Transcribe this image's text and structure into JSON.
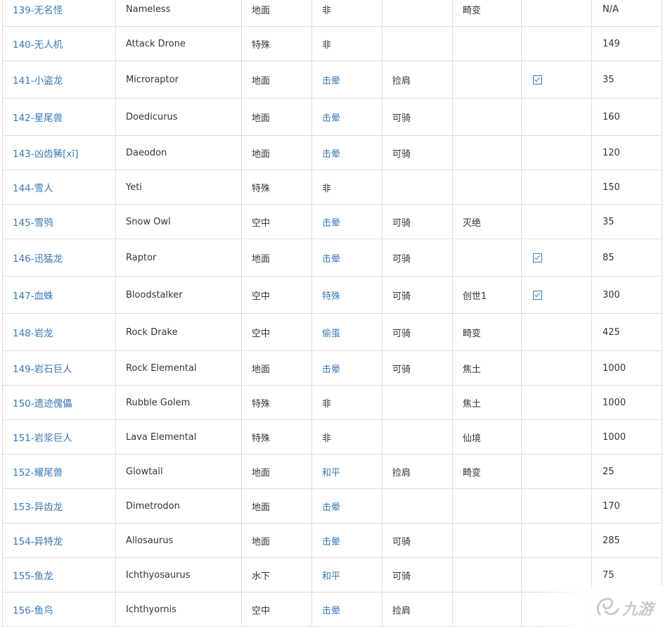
{
  "table": {
    "rows": [
      {
        "id": "139-无名怪",
        "name": "Nameless",
        "habitat": "地面",
        "tame": "非",
        "use": "",
        "map": "畸变",
        "extra": "",
        "value": "N/A",
        "tame_link": false,
        "checked": false
      },
      {
        "id": "140-无人机",
        "name": "Attack Drone",
        "habitat": "特殊",
        "tame": "非",
        "use": "",
        "map": "",
        "extra": "",
        "value": "149",
        "tame_link": false,
        "checked": false
      },
      {
        "id": "141-小盗龙",
        "name": "Microraptor",
        "habitat": "地面",
        "tame": "击晕",
        "use": "捡肩",
        "map": "",
        "extra": "",
        "value": "35",
        "tame_link": true,
        "checked": true
      },
      {
        "id": "142-星尾兽",
        "name": "Doedicurus",
        "habitat": "地面",
        "tame": "击晕",
        "use": "可骑",
        "map": "",
        "extra": "",
        "value": "160",
        "tame_link": true,
        "checked": false
      },
      {
        "id": "143-凶齿豨[xī]",
        "name": "Daeodon",
        "habitat": "地面",
        "tame": "击晕",
        "use": "可骑",
        "map": "",
        "extra": "",
        "value": "120",
        "tame_link": true,
        "checked": false
      },
      {
        "id": "144-雪人",
        "name": "Yeti",
        "habitat": "特殊",
        "tame": "非",
        "use": "",
        "map": "",
        "extra": "",
        "value": "150",
        "tame_link": false,
        "checked": false
      },
      {
        "id": "145-雪鸮",
        "name": "Snow Owl",
        "habitat": "空中",
        "tame": "击晕",
        "use": "可骑",
        "map": "灭绝",
        "extra": "",
        "value": "35",
        "tame_link": true,
        "checked": false
      },
      {
        "id": "146-迅猛龙",
        "name": "Raptor",
        "habitat": "地面",
        "tame": "击晕",
        "use": "可骑",
        "map": "",
        "extra": "",
        "value": "85",
        "tame_link": true,
        "checked": true
      },
      {
        "id": "147-血蛛",
        "name": "Bloodstalker",
        "habitat": "空中",
        "tame": "特殊",
        "use": "可骑",
        "map": "创世1",
        "extra": "",
        "value": "300",
        "tame_link": true,
        "checked": true
      },
      {
        "id": "148-岩龙",
        "name": "Rock Drake",
        "habitat": "空中",
        "tame": "偷蛋",
        "use": "可骑",
        "map": "畸变",
        "extra": "",
        "value": "425",
        "tame_link": true,
        "checked": false
      },
      {
        "id": "149-岩石巨人",
        "name": "Rock Elemental",
        "habitat": "地面",
        "tame": "击晕",
        "use": "可骑",
        "map": "焦土",
        "extra": "",
        "value": "1000",
        "tame_link": true,
        "checked": false
      },
      {
        "id": "150-遗迹傀儡",
        "name": "Rubble Golem",
        "habitat": "特殊",
        "tame": "非",
        "use": "",
        "map": "焦土",
        "extra": "",
        "value": "1000",
        "tame_link": false,
        "checked": false
      },
      {
        "id": "151-岩浆巨人",
        "name": "Lava Elemental",
        "habitat": "特殊",
        "tame": "非",
        "use": "",
        "map": "仙境",
        "extra": "",
        "value": "1000",
        "tame_link": false,
        "checked": false
      },
      {
        "id": "152-耀尾兽",
        "name": "Glowtail",
        "habitat": "地面",
        "tame": "和平",
        "use": "捡肩",
        "map": "畸变",
        "extra": "",
        "value": "25",
        "tame_link": true,
        "checked": false
      },
      {
        "id": "153-异齿龙",
        "name": "Dimetrodon",
        "habitat": "地面",
        "tame": "击晕",
        "use": "",
        "map": "",
        "extra": "",
        "value": "170",
        "tame_link": true,
        "checked": false
      },
      {
        "id": "154-异特龙",
        "name": "Allosaurus",
        "habitat": "地面",
        "tame": "击晕",
        "use": "可骑",
        "map": "",
        "extra": "",
        "value": "285",
        "tame_link": true,
        "checked": false
      },
      {
        "id": "155-鱼龙",
        "name": "Ichthyosaurus",
        "habitat": "水下",
        "tame": "和平",
        "use": "可骑",
        "map": "",
        "extra": "",
        "value": "75",
        "tame_link": true,
        "checked": false
      },
      {
        "id": "156-鱼鸟",
        "name": "Ichthyornis",
        "habitat": "空中",
        "tame": "击晕",
        "use": "捡肩",
        "map": "",
        "extra": "",
        "value": "",
        "tame_link": true,
        "checked": false
      }
    ]
  },
  "watermark": {
    "text": "九游",
    "icon": "jiuyou-logo-icon"
  },
  "colors": {
    "link": "#3a78b5",
    "border": "#dcdcdc",
    "text": "#333333"
  }
}
